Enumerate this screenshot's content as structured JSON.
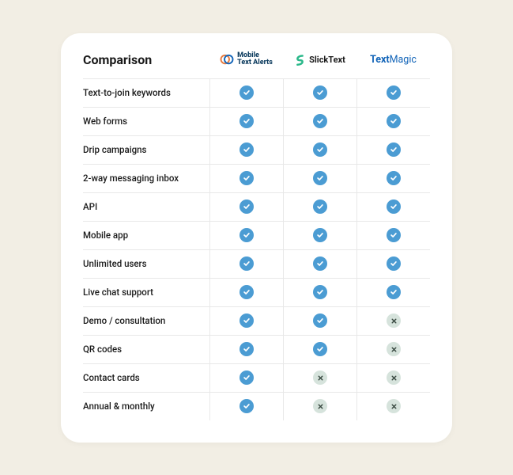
{
  "title": "Comparison",
  "providers": {
    "mta": {
      "line1": "Mobile",
      "line2": "Text Alerts"
    },
    "slick": {
      "name": "SlickText"
    },
    "textmagic": {
      "text": "Text",
      "magic": "Magic"
    }
  },
  "rows": [
    {
      "label": "Text-to-join keywords",
      "values": [
        true,
        true,
        true
      ]
    },
    {
      "label": "Web forms",
      "values": [
        true,
        true,
        true
      ]
    },
    {
      "label": "Drip campaigns",
      "values": [
        true,
        true,
        true
      ]
    },
    {
      "label": "2-way messaging inbox",
      "values": [
        true,
        true,
        true
      ]
    },
    {
      "label": "API",
      "values": [
        true,
        true,
        true
      ]
    },
    {
      "label": "Mobile app",
      "values": [
        true,
        true,
        true
      ]
    },
    {
      "label": "Unlimited users",
      "values": [
        true,
        true,
        true
      ]
    },
    {
      "label": "Live chat support",
      "values": [
        true,
        true,
        true
      ]
    },
    {
      "label": "Demo / consultation",
      "values": [
        true,
        true,
        false
      ]
    },
    {
      "label": "QR codes",
      "values": [
        true,
        true,
        false
      ]
    },
    {
      "label": "Contact cards",
      "values": [
        true,
        false,
        false
      ]
    },
    {
      "label": "Annual & monthly",
      "values": [
        true,
        false,
        false
      ]
    }
  ],
  "chart_data": {
    "type": "table",
    "title": "Comparison",
    "categories": [
      "Mobile Text Alerts",
      "SlickText",
      "TextMagic"
    ],
    "series": [
      {
        "name": "Text-to-join keywords",
        "values": [
          1,
          1,
          1
        ]
      },
      {
        "name": "Web forms",
        "values": [
          1,
          1,
          1
        ]
      },
      {
        "name": "Drip campaigns",
        "values": [
          1,
          1,
          1
        ]
      },
      {
        "name": "2-way messaging inbox",
        "values": [
          1,
          1,
          1
        ]
      },
      {
        "name": "API",
        "values": [
          1,
          1,
          1
        ]
      },
      {
        "name": "Mobile app",
        "values": [
          1,
          1,
          1
        ]
      },
      {
        "name": "Unlimited users",
        "values": [
          1,
          1,
          1
        ]
      },
      {
        "name": "Live chat support",
        "values": [
          1,
          1,
          1
        ]
      },
      {
        "name": "Demo / consultation",
        "values": [
          1,
          1,
          0
        ]
      },
      {
        "name": "QR codes",
        "values": [
          1,
          1,
          0
        ]
      },
      {
        "name": "Contact cards",
        "values": [
          1,
          0,
          0
        ]
      },
      {
        "name": "Annual & monthly",
        "values": [
          1,
          0,
          0
        ]
      }
    ]
  }
}
